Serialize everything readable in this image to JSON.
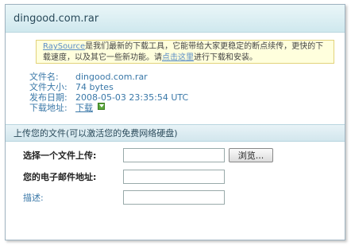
{
  "title": "dingood.com.rar",
  "notice": {
    "link1": "RaySource",
    "text1": "是我们最新的下载工具，它能带给大家更稳定的断点续传，更快的下载速度，以及其它一些新功能。请",
    "link2": "点击这里",
    "text2": "进行下载和安装。"
  },
  "file_info": {
    "name_label": "文件名:",
    "name_value": "dingood.com.rar",
    "size_label": "文件大小:",
    "size_value": "74 bytes",
    "date_label": "发布日期:",
    "date_value": "2008-05-03 23:35:54 UTC",
    "download_label": "下载地址:",
    "download_link": "下载"
  },
  "upload_section": {
    "title": "上传您的文件(可以激活您的免费网络硬盘)",
    "file_label": "选择一个文件上传:",
    "browse_label": "浏览...",
    "email_label": "您的电子邮件地址:",
    "desc_label": "描述:",
    "file_value": "",
    "email_value": "",
    "desc_value": ""
  }
}
